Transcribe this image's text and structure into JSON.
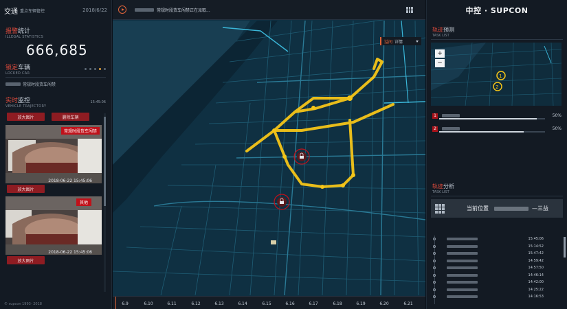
{
  "header": {
    "app_title": "交通",
    "app_subtitle": "重点车辆管控",
    "date": "2018/6/22"
  },
  "illegal_stats": {
    "title_red": "报警",
    "title_white": "统计",
    "subtitle": "ILLEGAL STATISTICS",
    "count": "666,685"
  },
  "locked_car": {
    "title_red": "锁定",
    "title_white": "车辆",
    "subtitle": "LOCKED CAR",
    "item_label": "常规时段货车闯禁"
  },
  "monitor": {
    "title_red": "实时",
    "title_white": "监控",
    "subtitle": "VEHICLE TRAJECTORY",
    "time": "15:45:06",
    "btn_enlarge": "放大图片",
    "btn_delete": "删除车辆",
    "cards": [
      {
        "tag": "常规时段货车闯禁",
        "time": "2018-06-22 15:45:06"
      },
      {
        "tag": "其他",
        "time": "2018-06-22 15:45:06"
      }
    ]
  },
  "copyright": "© supcon 1993- 2018",
  "ticker": {
    "text": "常规时段货车闯禁正在派取..."
  },
  "map_select": {
    "highlight": "溢间",
    "detail": "详情"
  },
  "timeline": {
    "ticks": [
      "6.9",
      "6.10",
      "6.11",
      "6.12",
      "6.13",
      "6.14",
      "6.15",
      "6.16",
      "6.17",
      "6.18",
      "6.19",
      "6.20",
      "6.21"
    ]
  },
  "brand": "中控 · SUPCON",
  "trajectory_preview": {
    "title_red": "轨迹",
    "title_white": "预测",
    "subtitle": "TASK LIST",
    "zoom_in": "+",
    "zoom_out": "−",
    "tasks": [
      {
        "num": "1",
        "pct": "50%",
        "fill": 0.92
      },
      {
        "num": "2",
        "pct": "50%",
        "fill": 0.8
      }
    ]
  },
  "trajectory_analysis": {
    "title_red": "轨迹",
    "title_white": "分析",
    "subtitle": "TASK LIST",
    "current_pos_label": "当前位置",
    "current_pos_value": "—三益",
    "times": [
      "15:45:06",
      "15:14:52",
      "15:47:42",
      "14:59:42",
      "14:57:50",
      "14:46:14",
      "14:42:00",
      "14:25:22",
      "14:16:53"
    ]
  },
  "colors": {
    "accent": "#e0643a",
    "alarm_red": "#a9131b",
    "route_yellow": "#f5c518"
  }
}
